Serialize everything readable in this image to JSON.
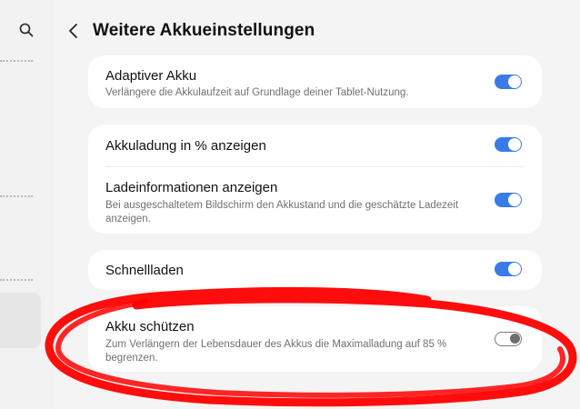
{
  "header": {
    "title": "Weitere Akkueinstellungen"
  },
  "settings": {
    "adaptive": {
      "title": "Adaptiver Akku",
      "subtitle": "Verlängere die Akkulaufzeit auf Grundlage deiner Tablet-Nutzung.",
      "enabled": true
    },
    "percent": {
      "title": "Akkuladung in % anzeigen",
      "enabled": true
    },
    "charge_info": {
      "title": "Ladeinformationen anzeigen",
      "subtitle": "Bei ausgeschaltetem Bildschirm den Akkustand und die geschätzte Ladezeit anzeigen.",
      "enabled": true
    },
    "fast_charge": {
      "title": "Schnellladen",
      "enabled": true
    },
    "protect": {
      "title": "Akku schützen",
      "subtitle": "Zum Verlängern der Lebensdauer des Akkus die Maximalladung auf 85 % begrenzen.",
      "enabled": false
    }
  },
  "colors": {
    "toggle_on": "#3a7be8",
    "annotation": "#ff0000"
  },
  "icons": {
    "search": "search-icon",
    "back": "back-arrow-icon"
  }
}
